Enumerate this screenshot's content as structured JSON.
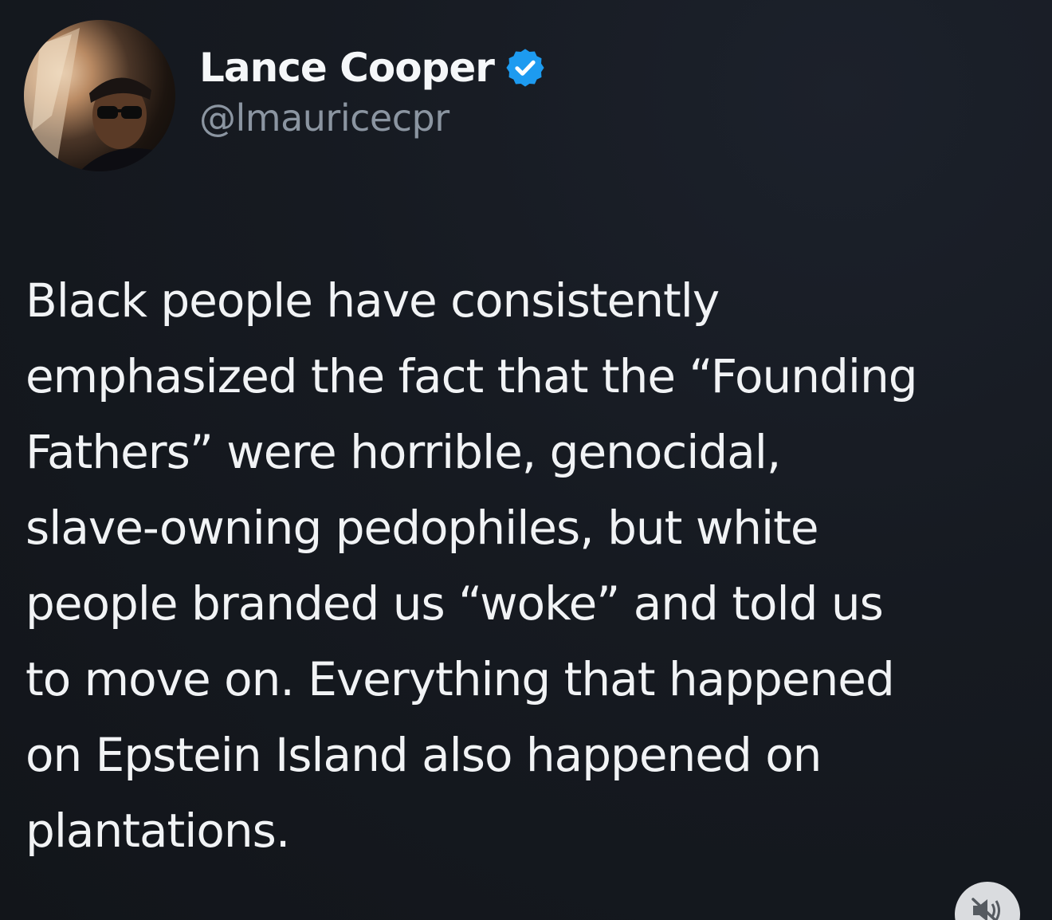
{
  "post": {
    "author": {
      "display_name": "Lance Cooper",
      "handle": "@lmauricecpr",
      "verified": true,
      "verified_icon": "verified-badge-icon",
      "verified_color": "#1d9bf0"
    },
    "text": "Black people have consistently\nemphasized the fact that the “Founding\nFathers” were horrible, genocidal,\nslave-owning pedophiles, but white\npeople branded us “woke” and told us\nto move on. Everything that happened\non Epstein Island also happened on\nplantations."
  },
  "media_controls": {
    "mute_icon": "speaker-muted-icon"
  },
  "colors": {
    "background": "#14171c",
    "text": "#f1f3f5",
    "handle": "#8b95a1",
    "accent": "#1d9bf0"
  }
}
